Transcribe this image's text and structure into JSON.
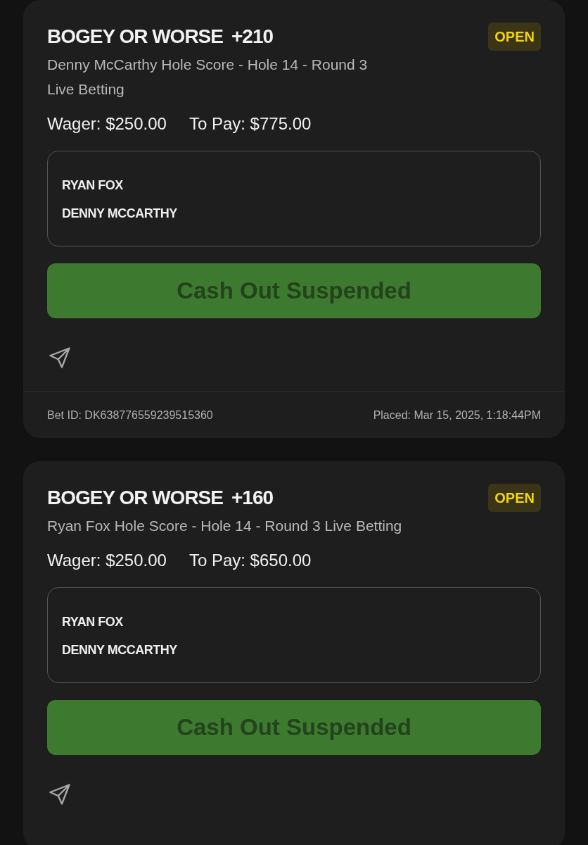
{
  "bets": [
    {
      "market": "BOGEY OR WORSE",
      "odds": "+210",
      "status": "OPEN",
      "description": "Denny McCarthy Hole Score - Hole 14 - Round 3",
      "description_line_2": "Live Betting",
      "wager": "Wager: $250.00",
      "to_pay": "To Pay: $775.00",
      "selections": [
        "RYAN FOX",
        "DENNY MCCARTHY"
      ],
      "cashout": {
        "label": "Cash Out Suspended",
        "disabled": true
      },
      "bet_id": "Bet ID: DK638776559239515360",
      "placed": "Placed: Mar 15, 2025, 1:18:44PM"
    },
    {
      "market": "BOGEY OR WORSE",
      "odds": "+160",
      "status": "OPEN",
      "description": "Ryan Fox Hole Score - Hole 14 - Round 3 Live Betting",
      "wager": "Wager: $250.00",
      "to_pay": "To Pay: $650.00",
      "selections": [
        "RYAN FOX",
        "DENNY MCCARTHY"
      ],
      "cashout": {
        "label": "Cash Out Suspended",
        "disabled": true
      }
    }
  ]
}
